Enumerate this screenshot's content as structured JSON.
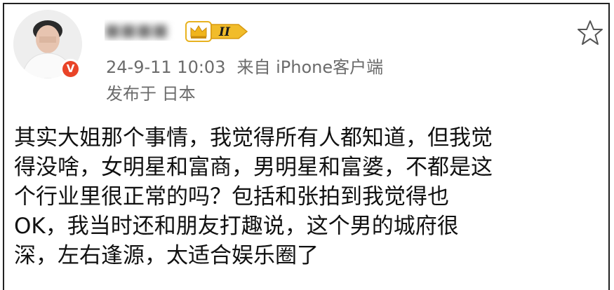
{
  "post": {
    "author": {
      "name_obscured": "■■■■",
      "avatar": "person-photo-blurred",
      "verified_badge": "V",
      "level_badge_label": "II",
      "level_badge_icon": "crown-icon"
    },
    "timestamp": "24-9-11 10:03",
    "source": "来自 iPhone客户端",
    "location": "发布于 日本",
    "favorite_icon": "star-outline-icon",
    "body_lines": [
      "其实大姐那个事情，我觉得所有人都知道，但我觉",
      "得没啥，女明星和富商，男明星和富婆，不都是这",
      "个行业里很正常的吗？包括和张拍到我觉得也",
      "OK，我当时还和朋友打趣说，这个男的城府很",
      "深，左右逢源，太适合娱乐圈了"
    ]
  },
  "colors": {
    "badge_red": "#e94428",
    "badge_gold": "#e8b21f",
    "meta_gray": "#6b6b6b",
    "text": "#111111"
  }
}
